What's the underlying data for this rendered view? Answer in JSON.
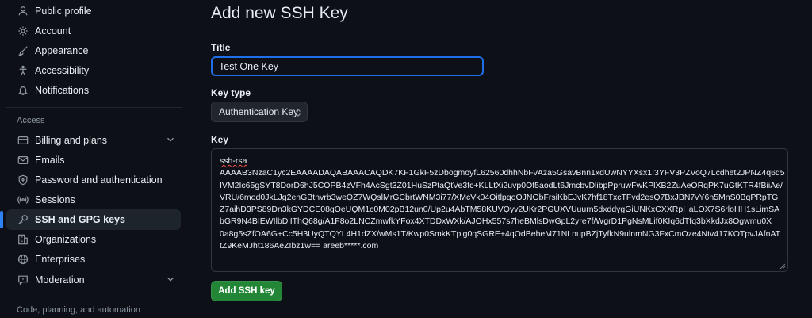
{
  "sidebar": {
    "items": [
      {
        "label": "Public profile",
        "icon": "person-icon"
      },
      {
        "label": "Account",
        "icon": "gear-icon"
      },
      {
        "label": "Appearance",
        "icon": "paintbrush-icon"
      },
      {
        "label": "Accessibility",
        "icon": "accessibility-icon"
      },
      {
        "label": "Notifications",
        "icon": "bell-icon"
      }
    ],
    "access_heading": "Access",
    "access_items": [
      {
        "label": "Billing and plans",
        "icon": "credit-card-icon",
        "expandable": true
      },
      {
        "label": "Emails",
        "icon": "mail-icon"
      },
      {
        "label": "Password and authentication",
        "icon": "shield-lock-icon"
      },
      {
        "label": "Sessions",
        "icon": "broadcast-icon"
      },
      {
        "label": "SSH and GPG keys",
        "icon": "key-icon",
        "active": true
      },
      {
        "label": "Organizations",
        "icon": "organization-icon"
      },
      {
        "label": "Enterprises",
        "icon": "globe-icon"
      },
      {
        "label": "Moderation",
        "icon": "report-icon",
        "expandable": true
      }
    ],
    "code_heading": "Code, planning, and automation"
  },
  "main": {
    "page_title": "Add new SSH Key",
    "title_label": "Title",
    "title_value": "Test One Key",
    "key_type_label": "Key type",
    "key_type_value": "Authentication Key",
    "key_label": "Key",
    "key_lines": [
      "ssh-rsa",
      "AAAAB3NzaC1yc2EAAAADAQABAAACAQDK7KF1GkF5zDbogmoyfL62560dhhNbFvAza5GsavBnn1xdUwNYYXsx1I3YFV3PZVoQ7Lcdhet2JPNZ4q6q5",
      "IVM2Ic65gSYT8DorD6hJ5COPB4zVFh4AcSgt3Z01HuSzPtaQtVe3fc+KLLtXi2uvp0Of5aodLt6JmcbvDlibpPpruwFwKPlXB2ZuAeORqPK7uGtKTR4fBiiAe/",
      "VRU/6mod0JkLJg2enGBtnvrb3weQZ7WQslMrGCbrtWNM3i77/XMcVk04OitlpqoOJNObFrsiKbEJvK7hf18TxcTFvd2esQ7BxJBN7vY6n5MnS0BqPRpTG",
      "Z7aihD3PS89Dn3kGYDCE08gOeUQM1c0M02pB12un0/Up2u4AbTM58KUVQyv2UKr2PGUXVUuurn5dxddygGiUNKxCXXRpHaLOX7S6rloHH1sLimSA",
      "bGR9N4BIEWIlbDiIThQ68g/A1F8o2LNCZmwfkYFox4XTDDxWXk/AJOHx557s7heBMlsDwGpL2yre7f/WgrD1PgNsMLif0KIq6dTfq3bXkdJx8Ogwmu0X",
      "0a8g5sZfOA6G+Cc5H3UyQTQYL4H1dZX/wMs1T/Kwp0SmkKTplg0qSGRE+4qOdBeheM71NLnupBZjTyfkN9ulnmNG3FxCmOze4Ntv417KOTpvJAfnAT",
      "tZ9KeMJht186AeZIbz1w== areeb*****.com"
    ],
    "submit_label": "Add SSH key"
  },
  "colors": {
    "background": "#0d1117",
    "accent_blue": "#2f81f7",
    "button_green": "#238636"
  }
}
